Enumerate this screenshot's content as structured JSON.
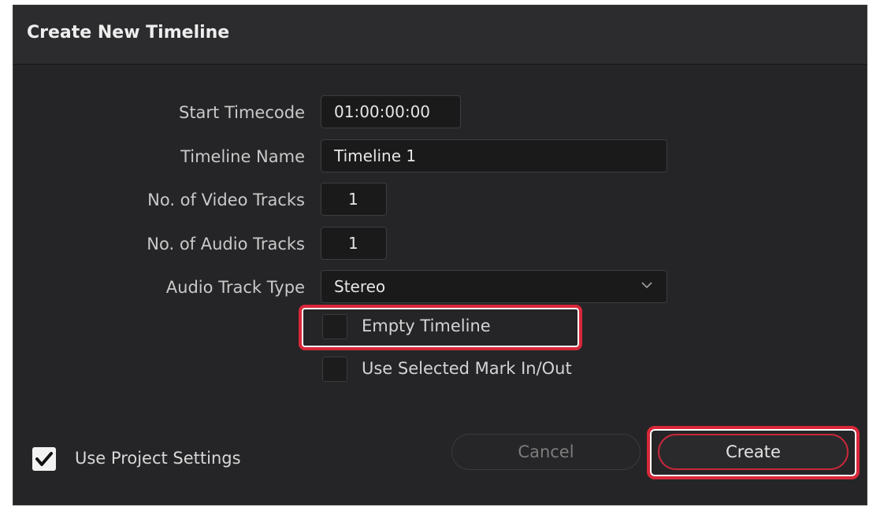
{
  "dialog": {
    "title": "Create New Timeline"
  },
  "fields": {
    "start_timecode": {
      "label": "Start Timecode",
      "value": "01:00:00:00"
    },
    "timeline_name": {
      "label": "Timeline Name",
      "value": "Timeline 1"
    },
    "video_tracks": {
      "label": "No. of Video Tracks",
      "value": "1"
    },
    "audio_tracks": {
      "label": "No. of Audio Tracks",
      "value": "1"
    },
    "audio_track_type": {
      "label": "Audio Track Type",
      "value": "Stereo"
    }
  },
  "options": {
    "empty_timeline": {
      "label": "Empty Timeline",
      "checked": false
    },
    "use_selected_mark": {
      "label": "Use Selected Mark In/Out",
      "checked": false
    },
    "use_project_settings": {
      "label": "Use Project Settings",
      "checked": true
    }
  },
  "buttons": {
    "cancel": "Cancel",
    "create": "Create"
  },
  "colors": {
    "highlight": "#d8283a",
    "dialog_bg": "#252527",
    "accent_border": "#c8283a"
  },
  "icons": {
    "dropdown": "chevron-down-icon",
    "check": "checkmark-icon"
  }
}
